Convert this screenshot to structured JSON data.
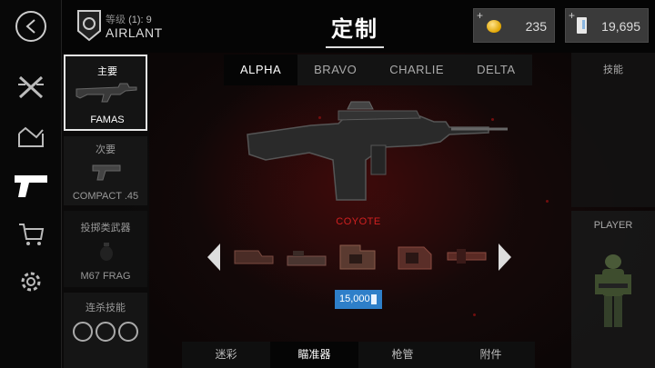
{
  "header": {
    "title": "定制",
    "level_label": "等级",
    "level_value": "(1): 9",
    "player_name": "AIRLANT",
    "coins": "235",
    "gold": "19,695",
    "plus": "+"
  },
  "categories": {
    "primary_label": "主要",
    "primary_weapon": "FAMAS",
    "secondary_label": "次要",
    "secondary_weapon": "COMPACT .45",
    "throwable_label": "投掷类武器",
    "throwable_weapon": "M67 FRAG",
    "killstreak_label": "连杀技能"
  },
  "loadout_tabs": [
    "ALPHA",
    "BRAVO",
    "CHARLIE",
    "DELTA"
  ],
  "active_loadout": "ALPHA",
  "right": {
    "skills_label": "技能",
    "player_label": "PLAYER"
  },
  "attachment": {
    "name": "COYOTE",
    "price": "15,000"
  },
  "bottom_tabs": [
    "迷彩",
    "瞄准器",
    "枪管",
    "附件"
  ],
  "active_bottom_tab": "瞄准器",
  "colors": {
    "accent_red": "#d02020",
    "price_blue": "#2e7fc9",
    "coin_gold": "#e0a400"
  },
  "icons": {
    "nav": [
      "back-icon",
      "weapons-crossed-icon",
      "crate-icon",
      "pistol-icon",
      "cart-icon",
      "gear-icon"
    ]
  }
}
